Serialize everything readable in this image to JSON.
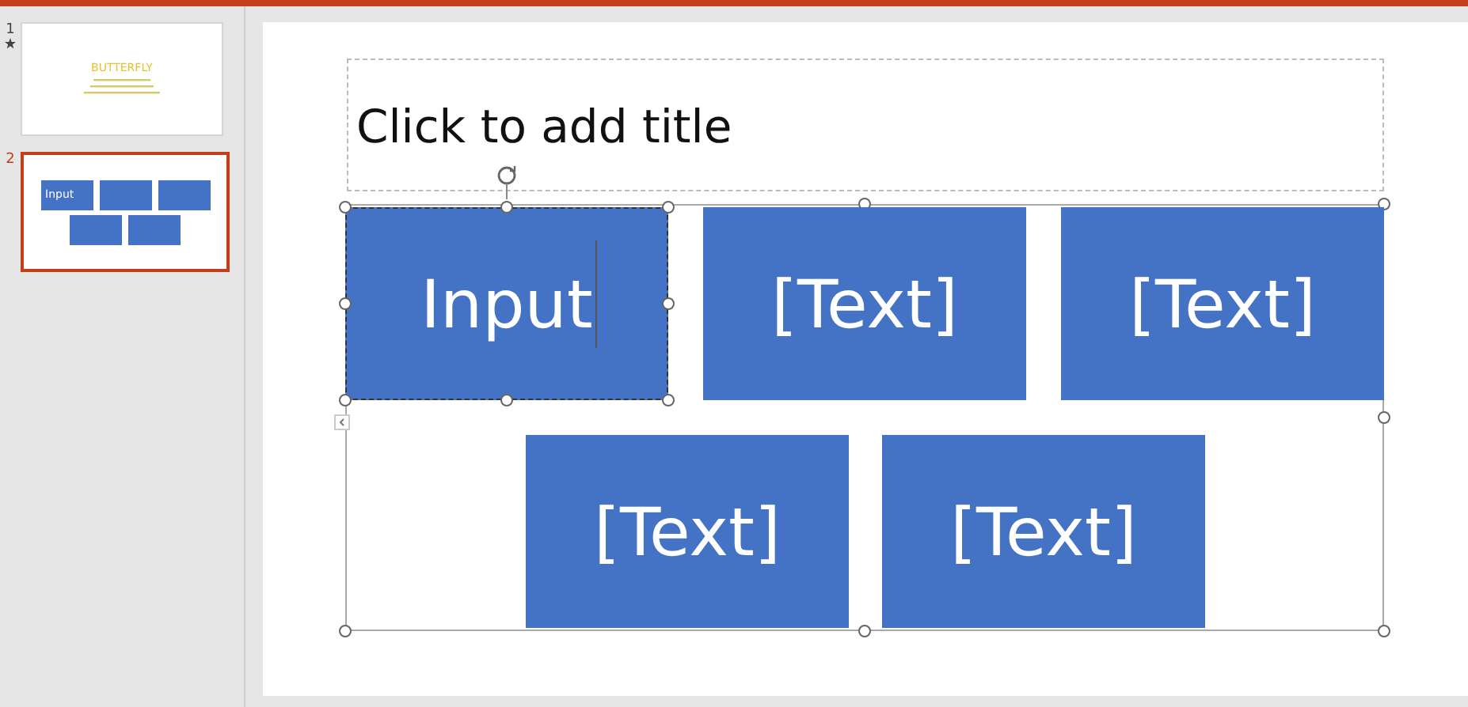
{
  "slides": [
    {
      "number": "1",
      "starred": true,
      "selected": false,
      "kind": "title",
      "title": "BUTTERFLY"
    },
    {
      "number": "2",
      "starred": false,
      "selected": true,
      "kind": "boxes",
      "first_label": "Input"
    }
  ],
  "slide": {
    "title_placeholder": "Click to add title",
    "boxes": [
      {
        "text": "Input",
        "selected": true
      },
      {
        "text": "[Text]",
        "selected": false
      },
      {
        "text": "[Text]",
        "selected": false
      },
      {
        "text": "[Text]",
        "selected": false
      },
      {
        "text": "[Text]",
        "selected": false
      }
    ]
  }
}
